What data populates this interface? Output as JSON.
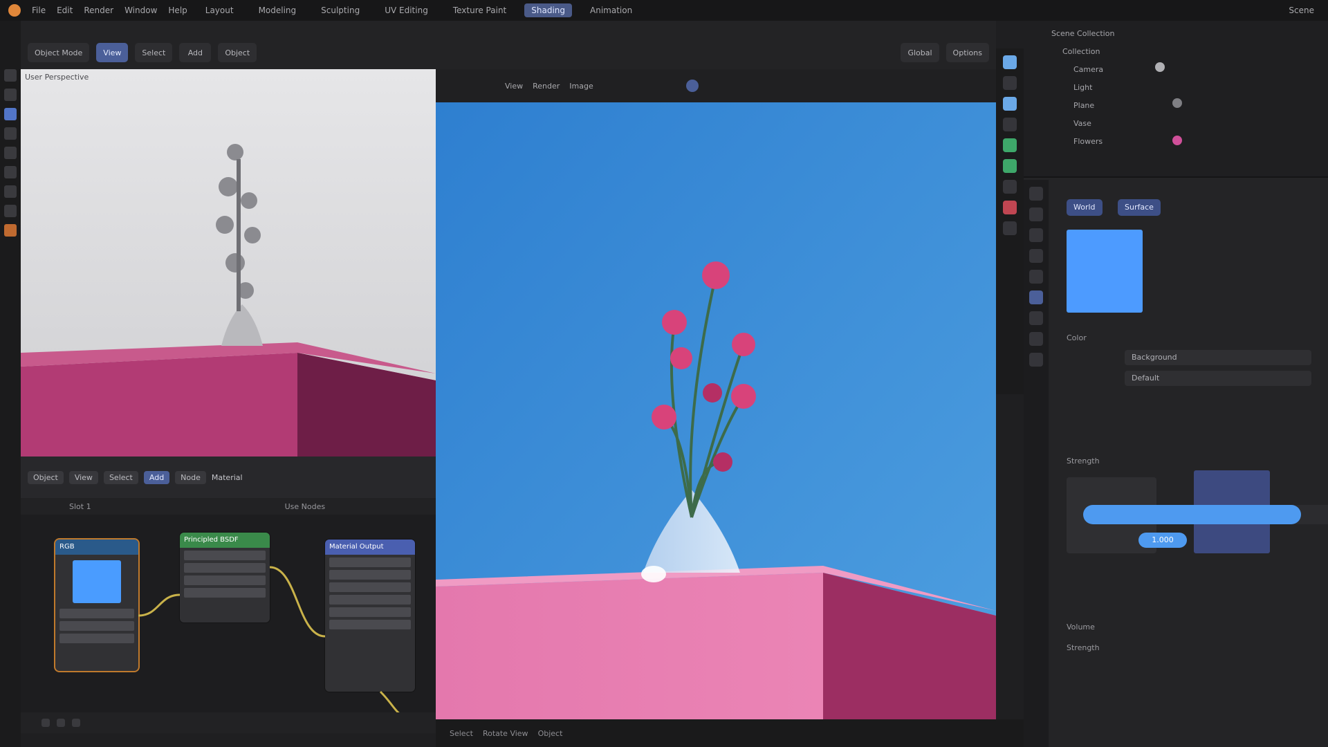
{
  "menubar": {
    "menus": [
      "File",
      "Edit",
      "Render",
      "Window",
      "Help"
    ],
    "workspaces": [
      "Layout",
      "Modeling",
      "Sculpting",
      "UV Editing",
      "Texture Paint",
      "Shading",
      "Animation"
    ],
    "active_workspace": "Shading",
    "scene": "Scene"
  },
  "toolbar": {
    "buttons": [
      "Object Mode",
      "View",
      "Select",
      "Add",
      "Object"
    ],
    "active_button": "View",
    "right_buttons": [
      "Global",
      "Options"
    ]
  },
  "solid_view": {
    "header_label": "User Perspective"
  },
  "node_editor": {
    "header_items": [
      "Object",
      "View",
      "Select",
      "Add",
      "Node"
    ],
    "active_item": "Add",
    "material": "Material",
    "sub_labels": [
      "Slot 1",
      "Use Nodes"
    ],
    "nodes": [
      {
        "title": "RGB",
        "color": "#2a5a8a"
      },
      {
        "title": "Principled BSDF",
        "color": "#3a8a4a"
      },
      {
        "title": "Material Output",
        "color": "#4a5fb0"
      }
    ]
  },
  "render_view": {
    "header_items": [
      "View",
      "Render",
      "Image"
    ],
    "colors": {
      "sky_top": "#2e7fd0",
      "sky_bottom": "#4e9fe0",
      "box_front": "#e478ad",
      "box_side": "#9c2e62",
      "flower": "#d8437a",
      "stem": "#3d6b4a"
    }
  },
  "outliner": {
    "items": [
      "Scene Collection",
      "Collection",
      "Camera",
      "Light",
      "Plane",
      "Vase",
      "Flowers"
    ]
  },
  "properties": {
    "tab_label": "World",
    "surface_label": "Surface",
    "color_label": "Color",
    "strength_label": "Strength",
    "volume_label": "Volume",
    "fields": [
      "Background",
      "Default"
    ],
    "slider_label": "Strength",
    "slider_value": 0.85,
    "slider_value_text": "1.000"
  },
  "statusbar": {
    "items": [
      "Select",
      "Rotate View",
      "Object"
    ]
  }
}
